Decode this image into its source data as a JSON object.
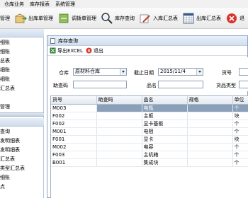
{
  "menu": [
    "仓库业务",
    "库存报表",
    "系统管理"
  ],
  "toolbar": [
    {
      "label": "管理",
      "icon": "book-icon"
    },
    {
      "label": "出库单管理",
      "icon": "box-out-icon"
    },
    {
      "label": "调拨单管理",
      "icon": "transfer-icon"
    },
    {
      "label": "库存查询",
      "icon": "magnifier-icon"
    },
    {
      "label": "入库汇总表",
      "icon": "pen-icon"
    },
    {
      "label": "出库汇总表",
      "icon": "calendar-icon"
    },
    {
      "label": "退",
      "icon": "exit-icon"
    }
  ],
  "sidebar": {
    "top_items": [
      "",
      "细账",
      "细账",
      "总表",
      "细账",
      "细账",
      "汇总表",
      "",
      "管理"
    ],
    "bottom_items": [
      "查询",
      "发明细表",
      "发明细表",
      "汇总表",
      "类型汇总表",
      "细账",
      "点"
    ]
  },
  "window": {
    "title": "库存查询",
    "export_label": "导出EXCEL",
    "exit_label": "退出"
  },
  "form": {
    "warehouse_label": "仓库",
    "warehouse_value": "原材料仓库",
    "date_label": "截止日期",
    "date_value": "2015/11/4",
    "code_label": "货号",
    "helper_label": "助查码",
    "name_label": "品名",
    "type_label": "货品类型"
  },
  "grid": {
    "columns": [
      "货号",
      "助查码",
      "品名",
      "规格",
      "单位"
    ],
    "rows": [
      {
        "code": "M003",
        "helper": "",
        "name": "电瓶",
        "spec": "",
        "unit": "个"
      },
      {
        "code": "F002",
        "helper": "",
        "name": "主板",
        "spec": "",
        "unit": "块"
      },
      {
        "code": "F002",
        "helper": "",
        "name": "显卡基板",
        "spec": "",
        "unit": "个"
      },
      {
        "code": "M001",
        "helper": "",
        "name": "电阻",
        "spec": "",
        "unit": "个"
      },
      {
        "code": "F001",
        "helper": "",
        "name": "显卡",
        "spec": "",
        "unit": "块"
      },
      {
        "code": "M002",
        "helper": "",
        "name": "电容",
        "spec": "",
        "unit": "个"
      },
      {
        "code": "F003",
        "helper": "",
        "name": "主机箱",
        "spec": "",
        "unit": "个"
      },
      {
        "code": "B001",
        "helper": "",
        "name": "集成块",
        "spec": "",
        "unit": "个"
      }
    ]
  }
}
